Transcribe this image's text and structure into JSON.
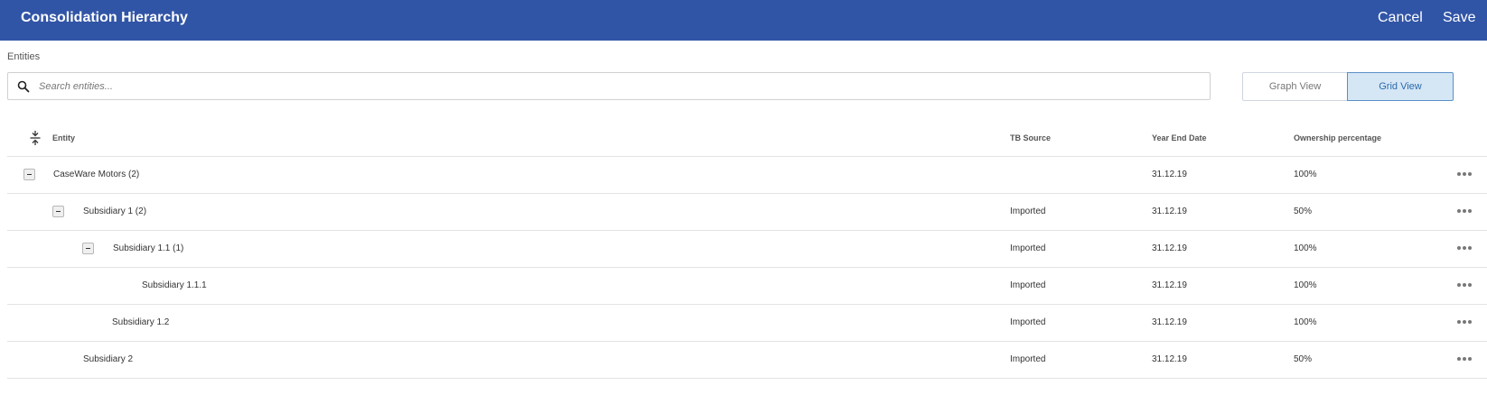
{
  "header": {
    "title": "Consolidation Hierarchy",
    "cancel_label": "Cancel",
    "save_label": "Save",
    "background_color": "#3155a6"
  },
  "entities_label": "Entities",
  "search": {
    "placeholder": "Search entities...",
    "value": "",
    "icon": "search-icon"
  },
  "views": {
    "graph_label": "Graph View",
    "grid_label": "Grid View",
    "active": "Grid View"
  },
  "table": {
    "columns": {
      "entity": "Entity",
      "tb_source": "TB Source",
      "year_end": "Year End Date",
      "ownership": "Ownership percentage"
    },
    "rows": [
      {
        "entity": "CaseWare Motors (2)",
        "tb_source": "",
        "year_end": "31.12.19",
        "ownership": "100%",
        "level": 0,
        "expanded": true
      },
      {
        "entity": "Subsidiary 1 (2)",
        "tb_source": "Imported",
        "year_end": "31.12.19",
        "ownership": "50%",
        "level": 1,
        "expanded": true
      },
      {
        "entity": "Subsidiary 1.1 (1)",
        "tb_source": "Imported",
        "year_end": "31.12.19",
        "ownership": "100%",
        "level": 2,
        "expanded": true
      },
      {
        "entity": "Subsidiary 1.1.1",
        "tb_source": "Imported",
        "year_end": "31.12.19",
        "ownership": "100%",
        "level": 3,
        "expanded": null
      },
      {
        "entity": "Subsidiary 1.2",
        "tb_source": "Imported",
        "year_end": "31.12.19",
        "ownership": "100%",
        "level": 2,
        "expanded": null
      },
      {
        "entity": "Subsidiary 2",
        "tb_source": "Imported",
        "year_end": "31.12.19",
        "ownership": "50%",
        "level": 1,
        "expanded": null
      }
    ]
  }
}
